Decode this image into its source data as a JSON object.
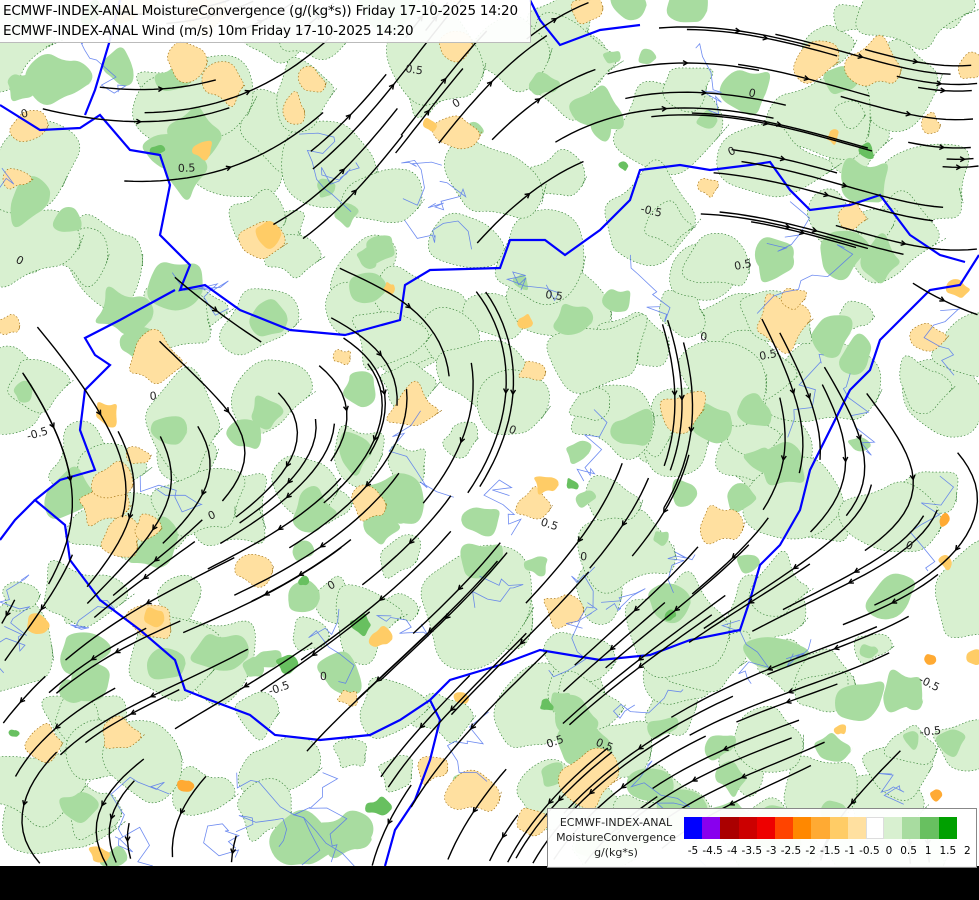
{
  "header": {
    "title_line_1": "ECMWF-INDEX-ANAL MoistureConvergence (g/(kg*s)) Friday 17-10-2025 14:20",
    "title_line_2": "ECMWF-INDEX-ANAL Wind (m/s) 10m Friday 17-10-2025 14:20"
  },
  "legend": {
    "line_1": "ECMWF-INDEX-ANAL",
    "line_2": "MoistureConvergence",
    "unit": "g/(kg*s)",
    "tick_labels": [
      "-5",
      "-4.5",
      "-4",
      "-3.5",
      "-3",
      "-2.5",
      "-2",
      "-1.5",
      "-1",
      "-0.5",
      "0",
      "0.5",
      "1",
      "1.5",
      "2"
    ],
    "colors": [
      "#0000ff",
      "#8800ee",
      "#aa0000",
      "#cc0000",
      "#ee0000",
      "#ff4400",
      "#ff8800",
      "#ffaa33",
      "#ffcc66",
      "#ffe0a0",
      "#ffffff",
      "#d8f0d0",
      "#a8dca0",
      "#68c060",
      "#00a000"
    ]
  },
  "map": {
    "contour_labels": [
      "0",
      "0.5",
      "-0.5",
      "0",
      "0.5",
      "0",
      "0",
      "0.5",
      "-0.5",
      "0",
      "0.5",
      "0",
      "-0.5",
      "0",
      "0.5",
      "0",
      "0.5",
      "0",
      "0",
      "-0.5",
      "0.5",
      "0",
      "0",
      "-0.5",
      "0.5",
      "0"
    ],
    "colors": {
      "background": "#ffffff",
      "light_green": "#d8f0d0",
      "mid_green": "#a8dca0",
      "dark_green": "#68c060",
      "light_orange": "#ffe0a0",
      "orange": "#ffcc66",
      "deep_orange": "#ffaa33",
      "border": "#0000ff",
      "river": "#5577ee",
      "streamline": "#000000"
    }
  }
}
